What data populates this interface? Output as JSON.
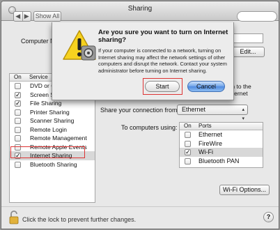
{
  "window": {
    "title": "Sharing"
  },
  "toolbar": {
    "show_all_label": "Show All"
  },
  "computer_name": {
    "label": "Computer Name:",
    "label_visible": "Computer N"
  },
  "edit_button": "Edit...",
  "services": {
    "col_on": "On",
    "col_service": "Service",
    "items": [
      {
        "label": "DVD or CD Sharing",
        "checked": false
      },
      {
        "label": "Screen Sharing",
        "checked": true
      },
      {
        "label": "File Sharing",
        "checked": true
      },
      {
        "label": "Printer Sharing",
        "checked": false
      },
      {
        "label": "Scanner Sharing",
        "checked": false
      },
      {
        "label": "Remote Login",
        "checked": false
      },
      {
        "label": "Remote Management",
        "checked": false
      },
      {
        "label": "Remote Apple Events",
        "checked": false
      },
      {
        "label": "Internet Sharing",
        "checked": true,
        "selected": true
      },
      {
        "label": "Bluetooth Sharing",
        "checked": false
      }
    ]
  },
  "connection_desc": {
    "line1": "nnection to the",
    "line2": "while Internet"
  },
  "share_from": {
    "label": "Share your connection from:",
    "value": "Ethernet"
  },
  "to_computers": {
    "label": "To computers using:",
    "col_on": "On",
    "col_ports": "Ports",
    "ports": [
      {
        "label": "Ethernet",
        "checked": false
      },
      {
        "label": "FireWire",
        "checked": false
      },
      {
        "label": "Wi-Fi",
        "checked": true,
        "selected": true
      },
      {
        "label": "Bluetooth PAN",
        "checked": false
      }
    ]
  },
  "wifi_options_button": "Wi-Fi Options...",
  "lock_text": "Click the lock to prevent further changes.",
  "help_label": "?",
  "dialog": {
    "title": "Are you sure you want to turn on Internet sharing?",
    "body": "If your computer is connected to a network, turning on Internet sharing may affect the network settings of other computers and disrupt the network. Contact your system administrator before turning on Internet sharing.",
    "start_label": "Start",
    "cancel_label": "Cancel"
  },
  "colors": {
    "highlight_box": "#dd3333",
    "default_button": "#4e8ae0"
  },
  "icons": [
    "warning-icon",
    "lock-icon",
    "help-icon",
    "checkmark-icon",
    "popup-arrows-icon"
  ]
}
